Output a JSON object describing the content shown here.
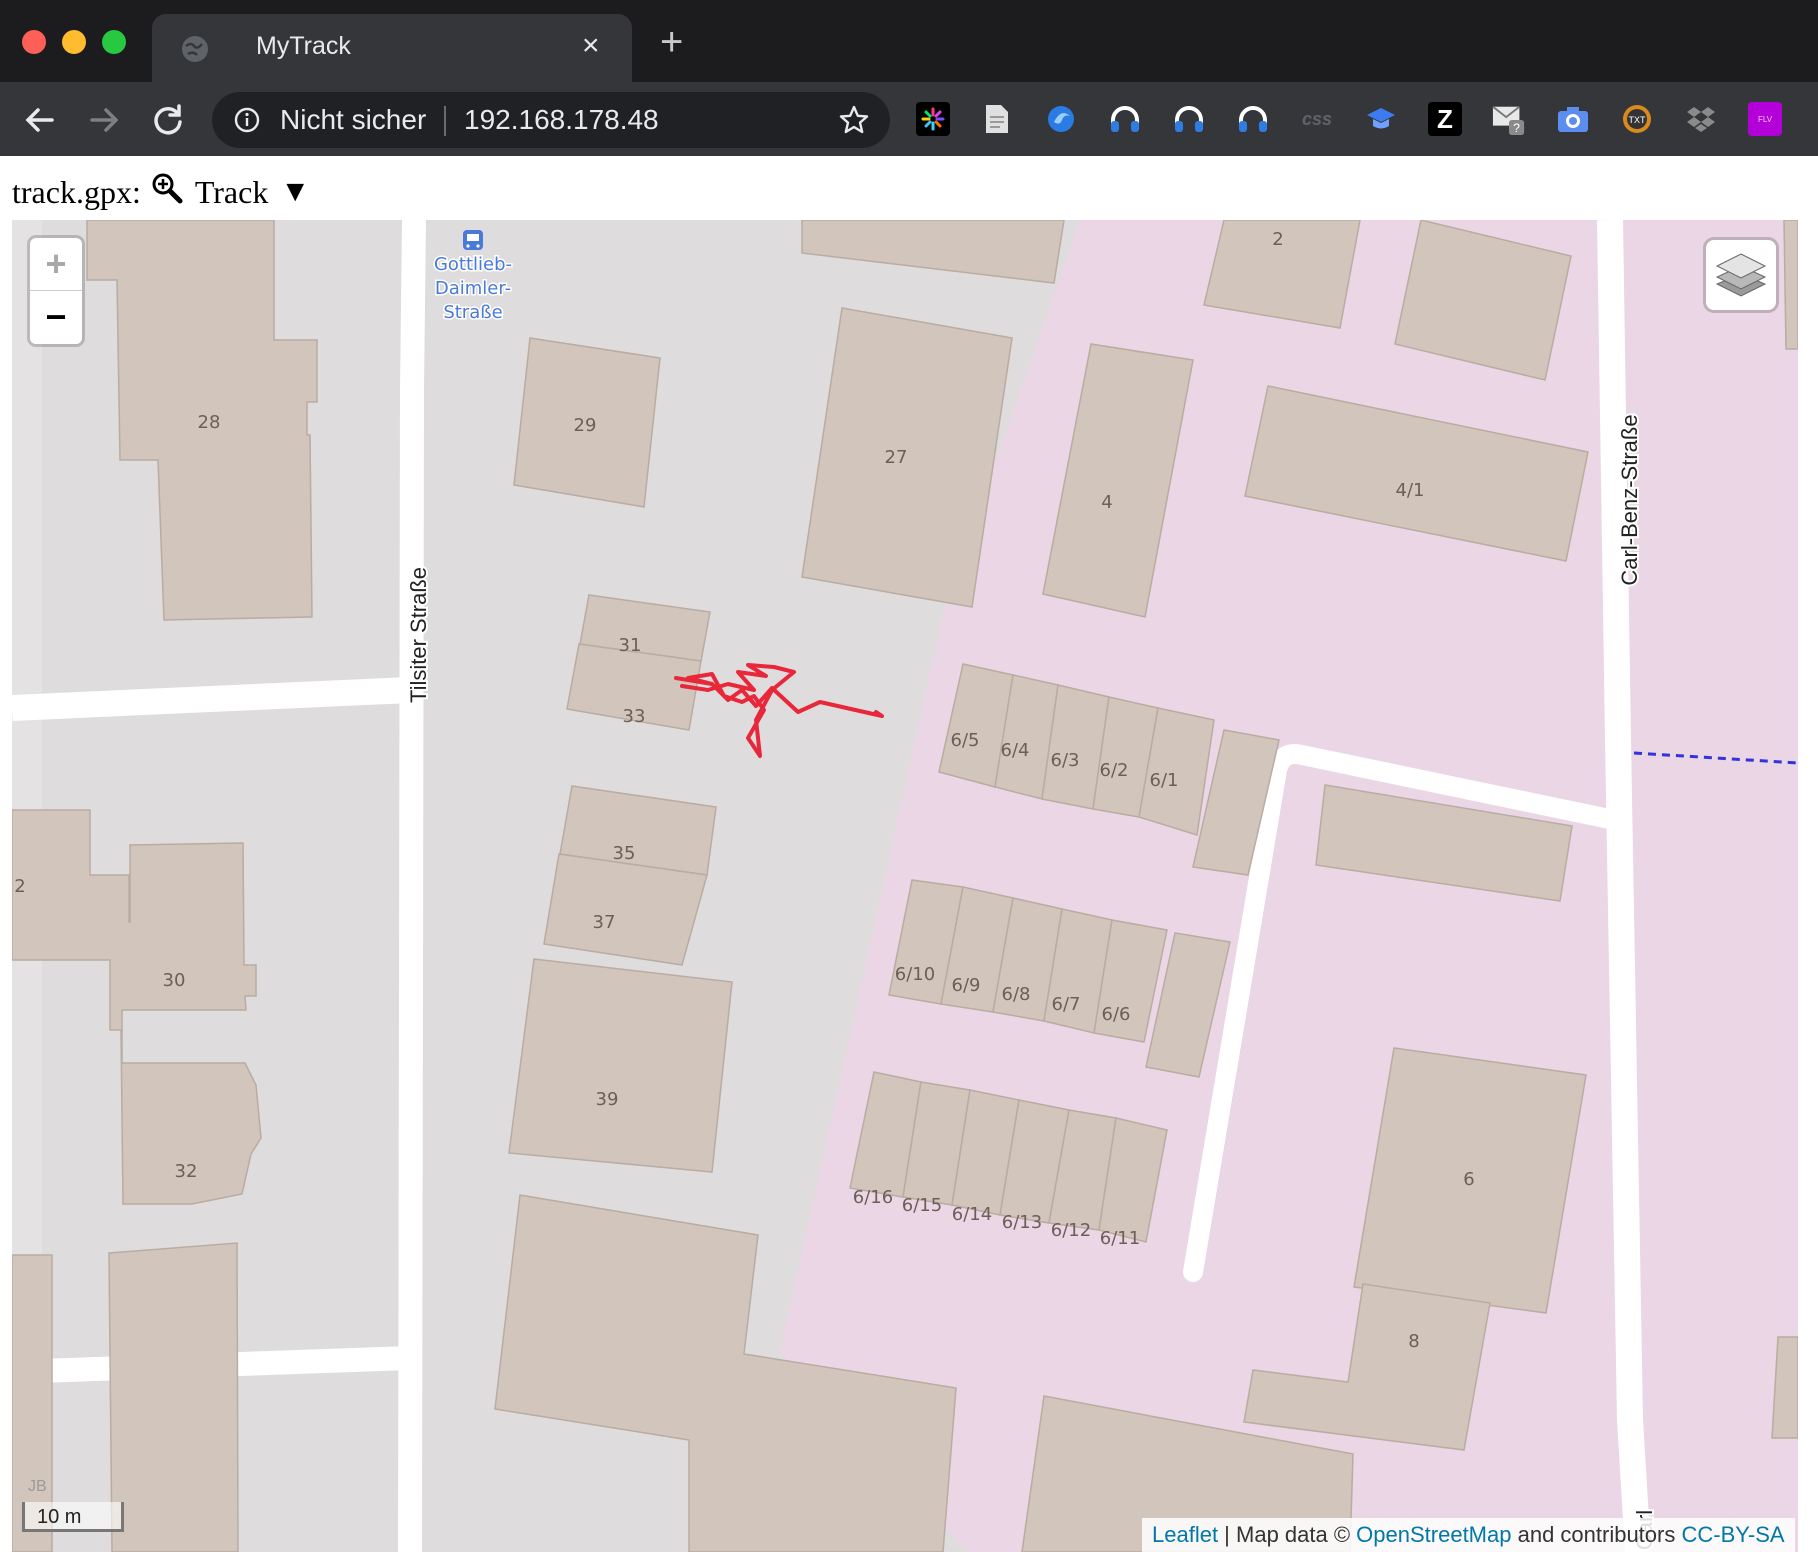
{
  "browser": {
    "tab_title": "MyTrack",
    "tab_close": "×",
    "new_tab": "+",
    "security_label": "Nicht sicher",
    "url": "192.168.178.48",
    "extensions": [
      "spectrum-icon",
      "document-icon",
      "firefox-relay-icon",
      "headphones-icon",
      "headphones-icon",
      "headphones-icon",
      "css-icon",
      "graduation-cap-icon",
      "z-icon",
      "mail-help-icon",
      "camera-icon",
      "txt-icon",
      "dropbox-icon",
      "purple-app-icon"
    ],
    "ext_texts": {
      "css": "css",
      "z": "Z",
      "mail_badge": "?",
      "txt": "TXT",
      "flv": "FLV"
    }
  },
  "page": {
    "filename": "track.gpx:",
    "track_label": "Track",
    "dropdown_arrow": "▼"
  },
  "map": {
    "bus_stop": [
      "Gottlieb-",
      "Daimler-",
      "Straße"
    ],
    "streets": {
      "tilsiter": "Tilsiter Straße",
      "carl_benz": "Carl-Benz-Straße",
      "carl_partial": "Carl"
    },
    "house_numbers": [
      "28",
      "29",
      "27",
      "2",
      "4",
      "4/1",
      "31",
      "33",
      "35",
      "37",
      "30",
      "32",
      "2",
      "39",
      "6/5",
      "6/4",
      "6/3",
      "6/2",
      "6/1",
      "6/10",
      "6/9",
      "6/8",
      "6/7",
      "6/6",
      "6/16",
      "6/15",
      "6/14",
      "6/13",
      "6/12",
      "6/11",
      "6",
      "8"
    ],
    "zoom_in": "+",
    "zoom_out": "−",
    "scale_label": "10 m",
    "jb_label": "JB",
    "attribution": {
      "leaflet": "Leaflet",
      "sep": " | Map data © ",
      "osm": "OpenStreetMap",
      "contrib": " and contributors ",
      "license": "CC-BY-SA"
    },
    "colors": {
      "track": "#e8273a",
      "boundary": "#3333dd",
      "building": "#d1c5bc",
      "industrial": "#ead6e4",
      "road": "#ffffff"
    }
  }
}
